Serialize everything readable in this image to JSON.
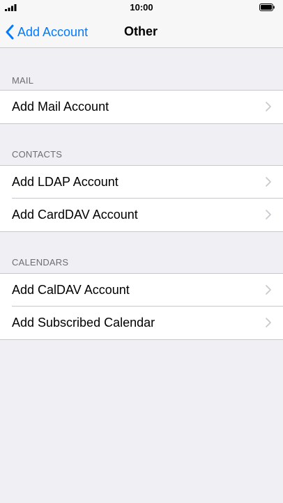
{
  "status_bar": {
    "time": "10:00",
    "signal_icon": "signal-bars-icon",
    "battery_icon": "battery-icon"
  },
  "nav": {
    "back_label": "Add Account",
    "title": "Other",
    "accent_color": "#007aff"
  },
  "sections": [
    {
      "header": "MAIL",
      "items": [
        {
          "label": "Add Mail Account"
        }
      ]
    },
    {
      "header": "CONTACTS",
      "items": [
        {
          "label": "Add LDAP Account"
        },
        {
          "label": "Add CardDAV Account"
        }
      ]
    },
    {
      "header": "CALENDARS",
      "items": [
        {
          "label": "Add CalDAV Account"
        },
        {
          "label": "Add Subscribed Calendar"
        }
      ]
    }
  ]
}
